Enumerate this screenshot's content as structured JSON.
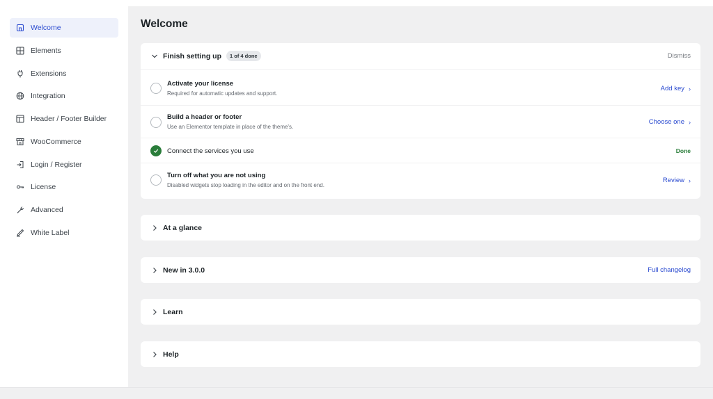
{
  "sidebar": {
    "items": [
      {
        "label": "Welcome",
        "icon": "home-icon",
        "active": true
      },
      {
        "label": "Elements",
        "icon": "grid-icon",
        "active": false
      },
      {
        "label": "Extensions",
        "icon": "plug-icon",
        "active": false
      },
      {
        "label": "Integration",
        "icon": "globe-icon",
        "active": false
      },
      {
        "label": "Header / Footer Builder",
        "icon": "layout-icon",
        "active": false
      },
      {
        "label": "WooCommerce",
        "icon": "store-icon",
        "active": false
      },
      {
        "label": "Login / Register",
        "icon": "login-icon",
        "active": false
      },
      {
        "label": "License",
        "icon": "key-icon",
        "active": false
      },
      {
        "label": "Advanced",
        "icon": "wrench-icon",
        "active": false
      },
      {
        "label": "White Label",
        "icon": "pen-icon",
        "active": false
      }
    ]
  },
  "main": {
    "title": "Welcome",
    "setup": {
      "title": "Finish setting up",
      "badge": "1 of 4 done",
      "dismiss": "Dismiss",
      "progress_fraction": 0.25,
      "tasks": [
        {
          "title": "Activate your license",
          "desc": "Required for automatic updates and support.",
          "action": "Add key",
          "arrow": "›",
          "done": false
        },
        {
          "title": "Build a header or footer",
          "desc": "Use an Elementor template in place of the theme's.",
          "action": "Choose one",
          "arrow": "›",
          "done": false
        },
        {
          "title": "Connect the services you use",
          "desc": "",
          "action": "Done",
          "arrow": "",
          "done": true
        },
        {
          "title": "Turn off what you are not using",
          "desc": "Disabled widgets stop loading in the editor and on the front end.",
          "action": "Review",
          "arrow": "›",
          "done": false
        }
      ]
    },
    "sections": [
      {
        "title": "At a glance",
        "link": ""
      },
      {
        "title": "New in 3.0.0",
        "link": "Full changelog"
      },
      {
        "title": "Learn",
        "link": ""
      },
      {
        "title": "Help",
        "link": ""
      }
    ]
  },
  "colors": {
    "accent": "#2b4bd0",
    "done": "#2a7d3a",
    "background": "#f0f0f1",
    "active_nav_bg": "#eef1fb"
  }
}
